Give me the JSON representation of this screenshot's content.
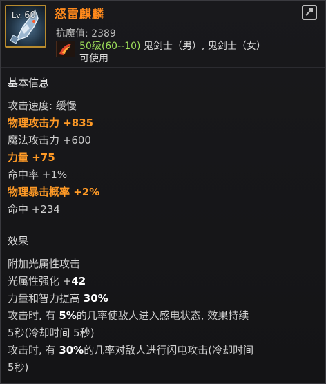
{
  "item": {
    "level_prefix": "Lv.",
    "level": "60",
    "name": "怒雷麒麟",
    "icon": "dragon-gauntlet-icon"
  },
  "header": {
    "anti_magic": "抗魔值: 2389",
    "req_level": "50级(60--10)",
    "req_classes": "鬼剑士（男）, 鬼剑士（女）",
    "usable": "可使用",
    "compare_icon": "compare-icon"
  },
  "basic": {
    "title": "基本信息",
    "lines": [
      "攻击速度: 缓慢",
      "物理攻击力 +835",
      "魔法攻击力 +600",
      "力量 +75",
      "命中率 +1%",
      "物理暴击概率 +2%",
      "命中 +234"
    ]
  },
  "effects": {
    "title": "效果",
    "l1": "附加光属性攻击",
    "l2_pre": "光属性强化 +",
    "l2_num": "42",
    "l3_pre": "力量和智力提高 ",
    "l3_num": "30%",
    "l4_pre": "攻击时, 有 ",
    "l4_num": "5%",
    "l4_post": "的几率使敌人进入感电状态, 效果持续",
    "l5": "5秒(冷却时间 5秒)",
    "l6_pre": "攻击时, 有 ",
    "l6_num": "30%",
    "l6_post": "的几率对敌人进行闪电攻击(冷却时间",
    "l7": "5秒)"
  },
  "colors": {
    "name": "#ff8a1c",
    "highlight_orange": "#ff9a26",
    "level_green": "#9ee05a",
    "border_gold": "#b88b2e"
  }
}
